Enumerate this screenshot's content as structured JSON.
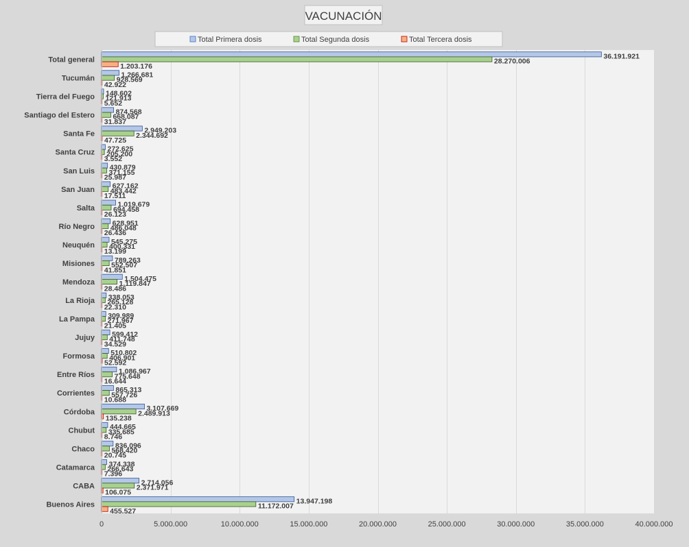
{
  "chart_data": {
    "type": "bar",
    "orientation": "horizontal",
    "title": "VACUNACIÓN",
    "categories": [
      "Total general",
      "Tucumán",
      "Tierra del Fuego",
      "Santiago del Estero",
      "Santa Fe",
      "Santa Cruz",
      "San Luis",
      "San Juan",
      "Salta",
      "Río Negro",
      "Neuquén",
      "Misiones",
      "Mendoza",
      "La Rioja",
      "La Pampa",
      "Jujuy",
      "Formosa",
      "Entre Ríos",
      "Corrientes",
      "Córdoba",
      "Chubut",
      "Chaco",
      "Catamarca",
      "CABA",
      "Buenos Aires"
    ],
    "series": [
      {
        "name": "Total Primera dosis",
        "color": "#b4c7e7",
        "values": [
          36191921,
          1266681,
          148602,
          874568,
          2949203,
          272625,
          430879,
          627162,
          1019679,
          628951,
          545275,
          789263,
          1504475,
          338053,
          309989,
          599412,
          510802,
          1086967,
          865313,
          3107669,
          444665,
          836096,
          374338,
          2714056,
          13947198
        ],
        "labels": [
          "36.191.921",
          "1.266.681",
          "148.602",
          "874.568",
          "2.949.203",
          "272.625",
          "430.879",
          "627.162",
          "1.019.679",
          "628.951",
          "545.275",
          "789.263",
          "1.504.475",
          "338.053",
          "309.989",
          "599.412",
          "510.802",
          "1.086.967",
          "865.313",
          "3.107.669",
          "444.665",
          "836.096",
          "374.338",
          "2.714.056",
          "13.947.198"
        ]
      },
      {
        "name": "Total Segunda dosis",
        "color": "#a9d18e",
        "values": [
          28270006,
          928569,
          121913,
          668087,
          2344692,
          205200,
          371155,
          483442,
          694458,
          486048,
          400331,
          552507,
          1119847,
          265128,
          271967,
          411748,
          406901,
          775648,
          557726,
          2489913,
          335685,
          568420,
          266643,
          2371971,
          11172007
        ],
        "labels": [
          "28.270.006",
          "928.569",
          "121.913",
          "668.087",
          "2.344.692",
          "205.200",
          "371.155",
          "483.442",
          "694.458",
          "486.048",
          "400.331",
          "552.507",
          "1.119.847",
          "265.128",
          "271.967",
          "411.748",
          "406.901",
          "775.648",
          "557.726",
          "2.489.913",
          "335.685",
          "568.420",
          "266.643",
          "2.371.971",
          "11.172.007"
        ]
      },
      {
        "name": "Total Tercera dosis",
        "color": "#f4b183",
        "values": [
          1203176,
          42922,
          5652,
          31837,
          47725,
          3552,
          25987,
          17511,
          26123,
          26436,
          13199,
          41851,
          28486,
          22310,
          21405,
          34529,
          52592,
          16644,
          10688,
          135238,
          8746,
          20745,
          7396,
          106075,
          455527
        ],
        "labels": [
          "1.203.176",
          "42.922",
          "5.652",
          "31.837",
          "47.725",
          "3.552",
          "25.987",
          "17.511",
          "26.123",
          "26.436",
          "13.199",
          "41.851",
          "28.486",
          "22.310",
          "21.405",
          "34.529",
          "52.592",
          "16.644",
          "10.688",
          "135.238",
          "8.746",
          "20.745",
          "7.396",
          "106.075",
          "455.527"
        ]
      }
    ],
    "xlim": [
      0,
      40000000
    ],
    "xticks": [
      0,
      5000000,
      10000000,
      15000000,
      20000000,
      25000000,
      30000000,
      35000000,
      40000000
    ],
    "xtick_labels": [
      "0",
      "5.000.000",
      "10.000.000",
      "15.000.000",
      "20.000.000",
      "25.000.000",
      "30.000.000",
      "35.000.000",
      "40.000.000"
    ],
    "grid": true,
    "legend_position": "top"
  }
}
